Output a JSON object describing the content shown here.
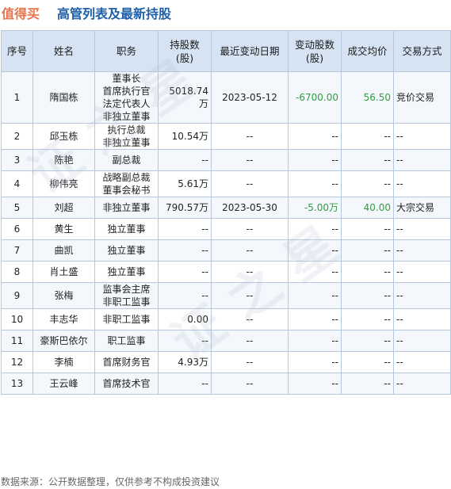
{
  "header": {
    "brand": "值得买",
    "title": "高管列表及最新持股"
  },
  "table": {
    "columns": [
      "序号",
      "姓名",
      "职务",
      "持股数\n(股)",
      "最近变动日期",
      "变动股数\n(股)",
      "成交均价",
      "交易方式"
    ],
    "rows": [
      {
        "idx": "1",
        "name": "隋国栋",
        "role": "董事长\n首席执行官\n法定代表人\n非独立董事",
        "hold": "5018.74万",
        "date": "2023-05-12",
        "chg": "-6700.00",
        "price": "56.50",
        "type": "竞价交易"
      },
      {
        "idx": "2",
        "name": "邱玉栋",
        "role": "执行总裁\n非独立董事",
        "hold": "10.54万",
        "date": "--",
        "chg": "--",
        "price": "--",
        "type": "--"
      },
      {
        "idx": "3",
        "name": "陈艳",
        "role": "副总裁",
        "hold": "--",
        "date": "--",
        "chg": "--",
        "price": "--",
        "type": "--"
      },
      {
        "idx": "4",
        "name": "柳伟亮",
        "role": "战略副总裁\n董事会秘书",
        "hold": "5.61万",
        "date": "--",
        "chg": "--",
        "price": "--",
        "type": "--"
      },
      {
        "idx": "5",
        "name": "刘超",
        "role": "非独立董事",
        "hold": "790.57万",
        "date": "2023-05-30",
        "chg": "-5.00万",
        "price": "40.00",
        "type": "大宗交易"
      },
      {
        "idx": "6",
        "name": "黄生",
        "role": "独立董事",
        "hold": "--",
        "date": "--",
        "chg": "--",
        "price": "--",
        "type": "--"
      },
      {
        "idx": "7",
        "name": "曲凯",
        "role": "独立董事",
        "hold": "--",
        "date": "--",
        "chg": "--",
        "price": "--",
        "type": "--"
      },
      {
        "idx": "8",
        "name": "肖土盛",
        "role": "独立董事",
        "hold": "--",
        "date": "--",
        "chg": "--",
        "price": "--",
        "type": "--"
      },
      {
        "idx": "9",
        "name": "张梅",
        "role": "监事会主席\n非职工监事",
        "hold": "--",
        "date": "--",
        "chg": "--",
        "price": "--",
        "type": "--"
      },
      {
        "idx": "10",
        "name": "丰志华",
        "role": "非职工监事",
        "hold": "0.00",
        "date": "--",
        "chg": "--",
        "price": "--",
        "type": "--"
      },
      {
        "idx": "11",
        "name": "豪斯巴依尔",
        "role": "职工监事",
        "hold": "--",
        "date": "--",
        "chg": "--",
        "price": "--",
        "type": "--"
      },
      {
        "idx": "12",
        "name": "李楠",
        "role": "首席财务官",
        "hold": "4.93万",
        "date": "--",
        "chg": "--",
        "price": "--",
        "type": "--"
      },
      {
        "idx": "13",
        "name": "王云峰",
        "role": "首席技术官",
        "hold": "--",
        "date": "--",
        "chg": "--",
        "price": "--",
        "type": "--"
      }
    ]
  },
  "footer": {
    "source": "数据来源：公开数据整理，仅供参考不构成投资建议"
  },
  "watermark": "证 之 星",
  "colors": {
    "brand": "#e8734a",
    "title": "#1f5fa8",
    "header_bg": "#d5e3f2",
    "change_text": "#2e9e3f"
  }
}
